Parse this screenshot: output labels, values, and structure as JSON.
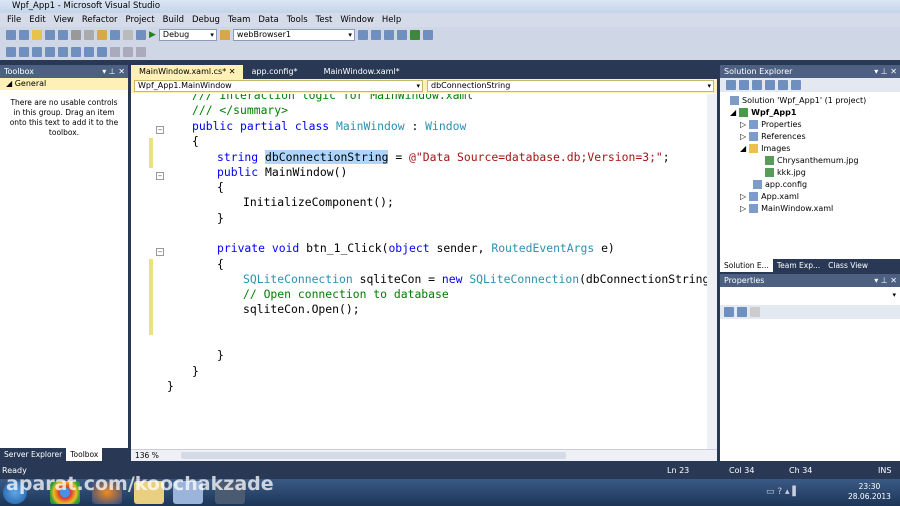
{
  "window": {
    "title": "Wpf_App1 - Microsoft Visual Studio"
  },
  "menu": [
    "File",
    "Edit",
    "View",
    "Refactor",
    "Project",
    "Build",
    "Debug",
    "Team",
    "Data",
    "Tools",
    "Test",
    "Window",
    "Help"
  ],
  "toolbar": {
    "config": "Debug",
    "target": "webBrowser1"
  },
  "toolbox": {
    "title": "Toolbox",
    "group": "General",
    "empty_text": "There are no usable controls in this group. Drag an item onto this text to add it to the toolbox.",
    "bottom_tabs": [
      "Server Explorer",
      "Toolbox"
    ]
  },
  "editor": {
    "tabs": [
      {
        "label": "MainWindow.xaml.cs*",
        "active": true
      },
      {
        "label": "app.config*"
      },
      {
        "label": "MainWindow.xaml*"
      }
    ],
    "nav_class": "Wpf_App1.MainWindow",
    "nav_member": "dbConnectionString",
    "zoom": "136 %",
    "code": {
      "l0": "/// Interaction logic for MainWindow.xaml",
      "l1": "/// </summary>",
      "l2a": "public partial class ",
      "l2b": "MainWindow",
      "l2c": " : ",
      "l2d": "Window",
      "brace_open": "{",
      "brace_close": "}",
      "l4a": "string ",
      "l4b": "dbConnectionString",
      "l4c": " = ",
      "l4d": "@\"Data Source=database.db;Version=3;\"",
      "l4e": ";",
      "l5a": "public ",
      "l5b": "MainWindow()",
      "l7": "InitializeComponent();",
      "l10a": "private void ",
      "l10b": "btn_1_Click(",
      "l10c": "object",
      " l10d": " sender, ",
      "l10e": "RoutedEventArgs",
      "l10f": " e)",
      "l12a": "SQLiteConnection",
      "l12b": " sqliteCon = ",
      "l12c": "new ",
      "l12d": "SQLiteConnection",
      "l12e": "(dbConnectionString);",
      "l13": "// Open connection to database",
      "l14": "sqliteCon.Open();"
    }
  },
  "solution_explorer": {
    "title": "Solution Explorer",
    "items": [
      "Solution 'Wpf_App1' (1 project)",
      "Wpf_App1",
      "Properties",
      "References",
      "Images",
      "Chrysanthemum.jpg",
      "kkk.jpg",
      "app.config",
      "App.xaml",
      "MainWindow.xaml"
    ],
    "tabs": [
      "Solution E...",
      "Team Exp...",
      "Class View"
    ]
  },
  "properties": {
    "title": "Properties"
  },
  "status": {
    "text": "Ready",
    "ln": "Ln 23",
    "col": "Col 34",
    "ch": "Ch 34",
    "mode": "INS"
  },
  "taskbar": {
    "time": "23:30",
    "date": "28.06.2013",
    "watermark": "aparat.com/koochakzade"
  }
}
